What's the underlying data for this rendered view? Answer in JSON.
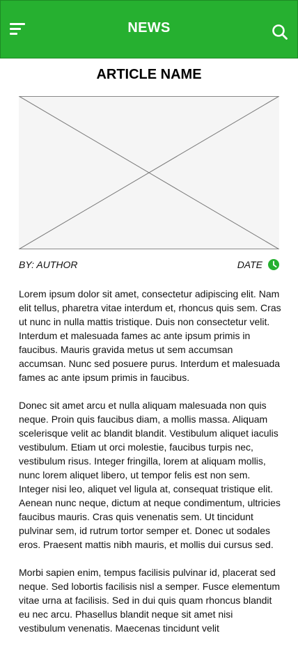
{
  "header": {
    "title": "NEWS",
    "background_color": "#26b030",
    "menu_icon": "hamburger-menu-icon",
    "search_icon": "search-icon"
  },
  "article": {
    "title": "ARTICLE NAME",
    "image_placeholder": "image-placeholder",
    "author": "BY: AUTHOR",
    "date": "DATE",
    "date_icon": "clock-icon",
    "accent_color": "#26b030",
    "paragraphs": [
      "Lorem ipsum dolor sit amet, consectetur adipiscing elit. Nam elit tellus, pharetra vitae interdum et, rhoncus quis sem. Cras ut nunc in nulla mattis tristique. Duis non consectetur velit. Interdum et malesuada fames ac ante ipsum primis in faucibus. Mauris gravida metus ut sem accumsan accumsan. Nunc sed posuere purus. Interdum et malesuada fames ac ante ipsum primis in faucibus.",
      "Donec sit amet arcu et nulla aliquam malesuada non quis neque. Proin quis faucibus diam, a mollis massa. Aliquam scelerisque velit ac blandit blandit. Vestibulum aliquet iaculis vestibulum. Etiam ut orci molestie, faucibus turpis nec, vestibulum risus. Integer fringilla, lorem at aliquam mollis, nunc lorem aliquet libero, ut tempor felis est non sem. Integer nisi leo, aliquet vel ligula at, consequat tristique elit. Aenean nunc neque, dictum at neque condimentum, ultricies faucibus mauris. Cras quis venenatis sem. Ut tincidunt pulvinar sem, id rutrum tortor semper et. Donec ut sodales eros. Praesent mattis nibh mauris, et mollis dui cursus sed.",
      "Morbi sapien enim, tempus facilisis pulvinar id, placerat sed neque. Sed lobortis facilisis nisl a semper. Fusce elementum vitae urna at facilisis. Sed in dui quis quam rhoncus blandit eu nec arcu. Phasellus blandit neque sit amet nisi vestibulum venenatis. Maecenas tincidunt velit"
    ]
  }
}
